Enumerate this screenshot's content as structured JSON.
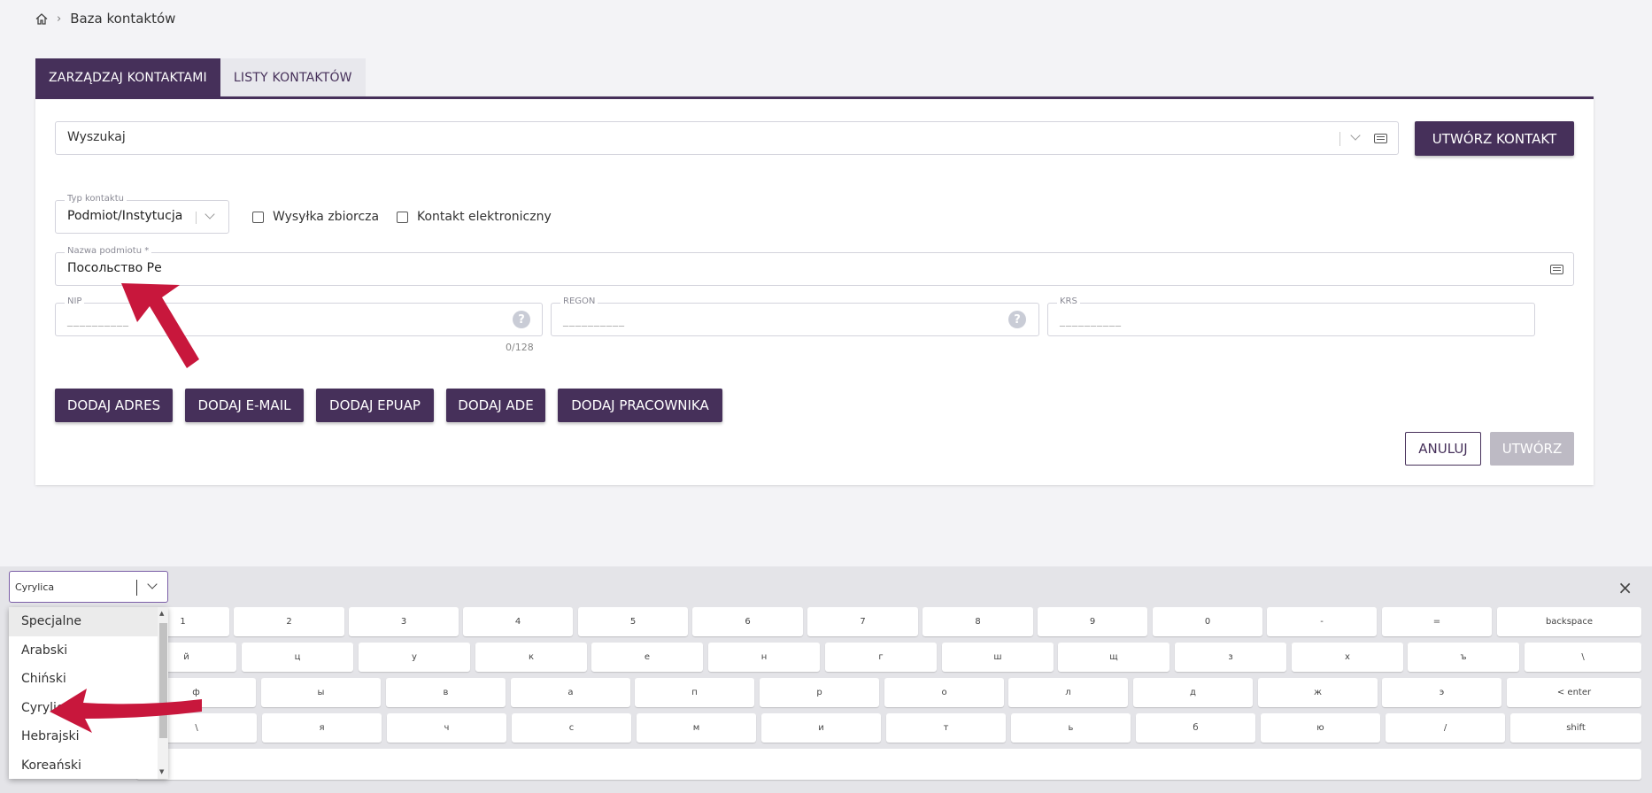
{
  "breadcrumb": {
    "current": "Baza kontaktów"
  },
  "tabs": [
    {
      "label": "ZARZĄDZAJ KONTAKTAMI",
      "active": true
    },
    {
      "label": "LISTY KONTAKTÓW",
      "active": false
    }
  ],
  "search": {
    "placeholder": "Wyszukaj"
  },
  "create_contact_button": "UTWÓRZ KONTAKT",
  "contact_type": {
    "label": "Typ kontaktu",
    "value": "Podmiot/Instytucja"
  },
  "checkboxes": {
    "bulk": "Wysyłka zbiorcza",
    "electronic": "Kontakt elektroniczny"
  },
  "entity_name": {
    "label": "Nazwa podmiotu *",
    "value": "Посольство Ре"
  },
  "nip": {
    "label": "NIP",
    "placeholder": "__________",
    "counter": "0/128"
  },
  "regon": {
    "label": "REGON",
    "placeholder": "__________"
  },
  "krs": {
    "label": "KRS",
    "placeholder": "__________"
  },
  "add_buttons": [
    "DODAJ ADRES",
    "DODAJ E-MAIL",
    "DODAJ EPUAP",
    "DODAJ ADE",
    "DODAJ PRACOWNIKA"
  ],
  "footer": {
    "cancel": "ANULUJ",
    "create": "UTWÓRZ"
  },
  "keyboard": {
    "layout_select": "Cyrylica",
    "close": "×",
    "rows": [
      [
        "1",
        "2",
        "3",
        "4",
        "5",
        "6",
        "7",
        "8",
        "9",
        "0",
        "-",
        "=",
        "backspace"
      ],
      [
        "й",
        "ц",
        "у",
        "к",
        "е",
        "н",
        "г",
        "ш",
        "щ",
        "з",
        "х",
        "ъ",
        "\\"
      ],
      [
        "ф",
        "ы",
        "в",
        "а",
        "п",
        "р",
        "о",
        "л",
        "д",
        "ж",
        "э",
        "< enter"
      ],
      [
        "\\",
        "я",
        "ч",
        "с",
        "м",
        "и",
        "т",
        "ь",
        "б",
        "ю",
        "/",
        "shift"
      ]
    ]
  },
  "layout_options": [
    "Specjalne",
    "Arabski",
    "Chiński",
    "Cyrylica",
    "Hebrajski",
    "Koreański"
  ],
  "colors": {
    "primary": "#46305a",
    "annotation_arrow": "#c8173c"
  }
}
